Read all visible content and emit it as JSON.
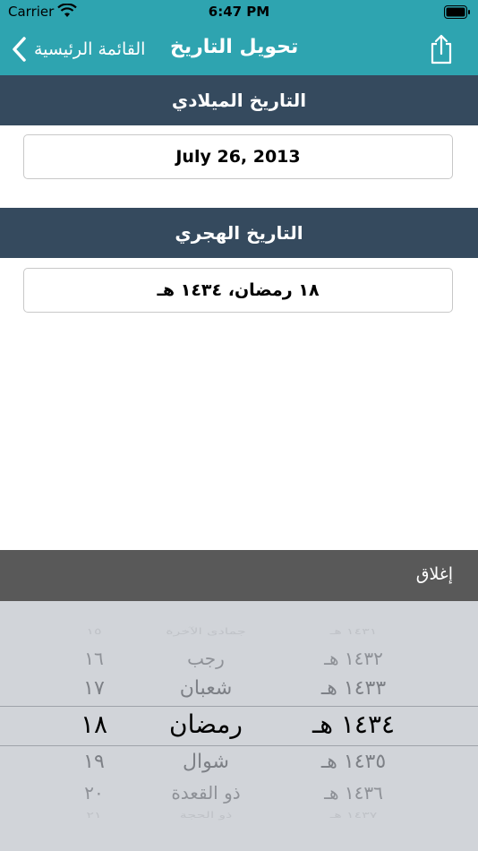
{
  "status_bar": {
    "carrier": "Carrier",
    "time": "6:47 PM"
  },
  "nav": {
    "back_label": "القائمة الرئيسية",
    "title": "تحويل التاريخ"
  },
  "gregorian": {
    "header": "التاريخ الميلادي",
    "value": "July 26, 2013"
  },
  "hijri": {
    "header": "التاريخ الهجري",
    "value": "١٨ رمضان، ١٤٣٤ هـ"
  },
  "toolbar": {
    "close_label": "إغلاق"
  },
  "picker": {
    "days": [
      "١٥",
      "١٦",
      "١٧",
      "١٨",
      "١٩",
      "٢٠",
      "٢١"
    ],
    "months": [
      "جمادى الآخرة",
      "رجب",
      "شعبان",
      "رمضان",
      "شوال",
      "ذو القعدة",
      "ذو الحجة"
    ],
    "years": [
      "١٤٣١ هـ",
      "١٤٣٢ هـ",
      "١٤٣٣ هـ",
      "١٤٣٤ هـ",
      "١٤٣٥ هـ",
      "١٤٣٦ هـ",
      "١٤٣٧ هـ"
    ],
    "selected_index": 3
  },
  "colors": {
    "nav_teal": "#2ea4b0",
    "section_navy": "#354a5e",
    "toolbar_gray": "#595959",
    "picker_bg": "#d1d4d9"
  }
}
